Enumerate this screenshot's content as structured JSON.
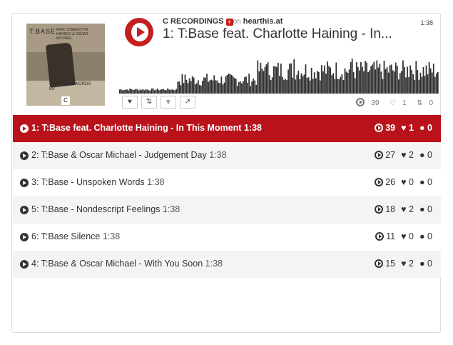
{
  "header": {
    "user": "C RECORDINGS",
    "on_text": "on",
    "site": "hearthis.at",
    "duration": "1:38",
    "title": "1: T:Base feat. Charlotte Haining - In..."
  },
  "artwork": {
    "brand": "T:BASE",
    "subtitle": "FEAT. CHARLOTTE HAINING & OSCAR MICHAEL",
    "words": "UNSPOKEN WORDS EP",
    "logo": "C"
  },
  "controls": {
    "like_icon": "heart-icon",
    "repost_icon": "repost-icon",
    "share_icon": "share-icon",
    "popout_icon": "external-link-icon",
    "plays": "39",
    "likes": "1",
    "reposts": "0"
  },
  "colors": {
    "accent": "#c41e1e",
    "active_row": "#b9121b",
    "waveform": "#2e2e2e"
  },
  "tracks": [
    {
      "name": "1: T:Base feat. Charlotte Haining - In This Moment",
      "duration": "1:38",
      "plays": "39",
      "likes": "1",
      "comments": "0"
    },
    {
      "name": "2: T:Base & Oscar Michael - Judgement Day",
      "duration": "1:38",
      "plays": "27",
      "likes": "2",
      "comments": "0"
    },
    {
      "name": "3: T:Base - Unspoken Words",
      "duration": "1:38",
      "plays": "26",
      "likes": "0",
      "comments": "0"
    },
    {
      "name": "5: T:Base - Nondescript Feelings",
      "duration": "1:38",
      "plays": "18",
      "likes": "2",
      "comments": "0"
    },
    {
      "name": "6: T:Base Silence",
      "duration": "1:38",
      "plays": "11",
      "likes": "0",
      "comments": "0"
    },
    {
      "name": "4: T:Base & Oscar Michael - With You Soon",
      "duration": "1:38",
      "plays": "15",
      "likes": "2",
      "comments": "0"
    }
  ]
}
